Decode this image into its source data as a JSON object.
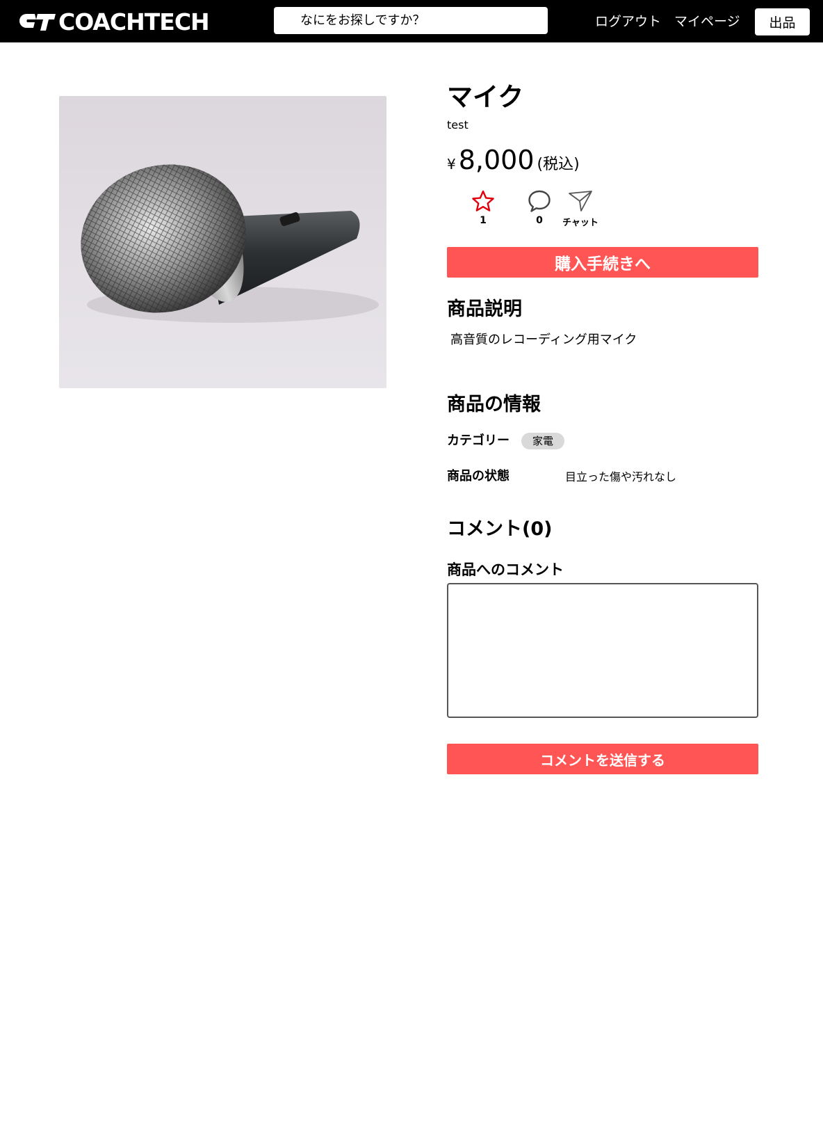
{
  "header": {
    "logo_text": "COACHTECH",
    "search_placeholder": "なにをお探しですか？",
    "logout_label": "ログアウト",
    "mypage_label": "マイページ",
    "sell_label": "出品"
  },
  "product": {
    "title": "マイク",
    "brand": "test",
    "currency_symbol": "¥",
    "price": "8,000",
    "tax_note": "(税込)",
    "like_count": "1",
    "comment_count": "0",
    "chat_label": "チャット",
    "like_color": "#e0000b",
    "buy_label": "購入手続きへ",
    "image_icon": "microphone-image"
  },
  "description": {
    "heading": "商品説明",
    "text": "高音質のレコーディング用マイク"
  },
  "info": {
    "heading": "商品の情報",
    "category_label": "カテゴリー",
    "category_value": "家電",
    "condition_label": "商品の状態",
    "condition_value": "目立った傷や汚れなし"
  },
  "comments": {
    "heading": "コメント(0)",
    "form_label": "商品へのコメント",
    "submit_label": "コメントを送信する"
  },
  "colors": {
    "accent": "#ff5555",
    "header_bg": "#000000"
  }
}
